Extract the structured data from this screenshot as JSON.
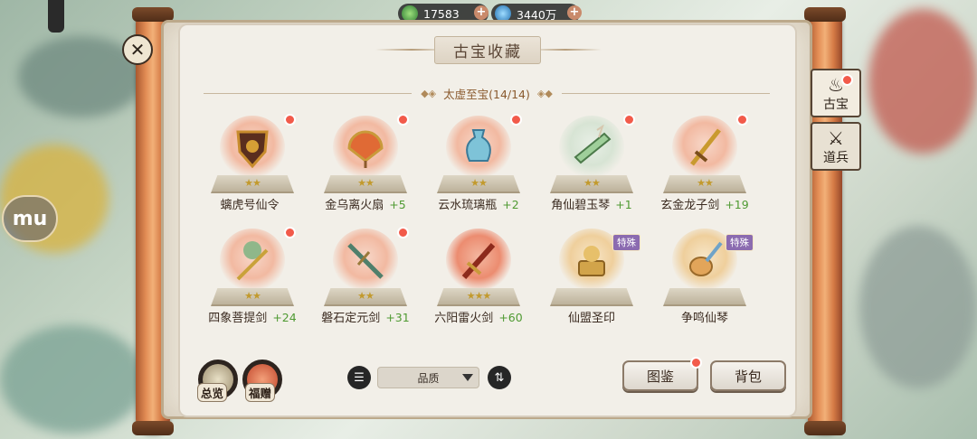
{
  "resources": {
    "jade": {
      "value": "17583",
      "icon": "jade-coin-icon"
    },
    "spirit": {
      "value": "3440万",
      "icon": "water-drop-icon"
    }
  },
  "header": {
    "title": "古宝收藏"
  },
  "section": {
    "title": "太虚至宝(14/14)"
  },
  "items": [
    {
      "name": "螭虎号仙令",
      "plus": "",
      "stars": "★★",
      "tag": "",
      "dot": true
    },
    {
      "name": "金乌离火扇",
      "plus": "+5",
      "stars": "★★",
      "tag": "",
      "dot": true
    },
    {
      "name": "云水琉璃瓶",
      "plus": "+2",
      "stars": "★★",
      "tag": "",
      "dot": true
    },
    {
      "name": "角仙碧玉琴",
      "plus": "+1",
      "stars": "★★",
      "tag": "",
      "dot": true
    },
    {
      "name": "玄金龙子剑",
      "plus": "+19",
      "stars": "★★",
      "tag": "",
      "dot": true
    },
    {
      "name": "四象菩提剑",
      "plus": "+24",
      "stars": "★★",
      "tag": "",
      "dot": true
    },
    {
      "name": "磐石定元剑",
      "plus": "+31",
      "stars": "★★",
      "tag": "",
      "dot": true
    },
    {
      "name": "六阳雷火剑",
      "plus": "+60",
      "stars": "★★★",
      "tag": "",
      "dot": false
    },
    {
      "name": "仙盟圣印",
      "plus": "",
      "stars": "",
      "tag": "特殊",
      "dot": false
    },
    {
      "name": "争鸣仙琴",
      "plus": "",
      "stars": "",
      "tag": "特殊",
      "dot": false
    }
  ],
  "bottom": {
    "overview_label": "总览",
    "gift_label": "福赠",
    "sort_value": "品质",
    "catalog_label": "图鉴",
    "bag_label": "背包"
  },
  "side_tabs": [
    {
      "label": "古宝",
      "icon": "cauldron-icon"
    },
    {
      "label": "道兵",
      "icon": "weapon-icon"
    }
  ],
  "mu_badge": "mu"
}
